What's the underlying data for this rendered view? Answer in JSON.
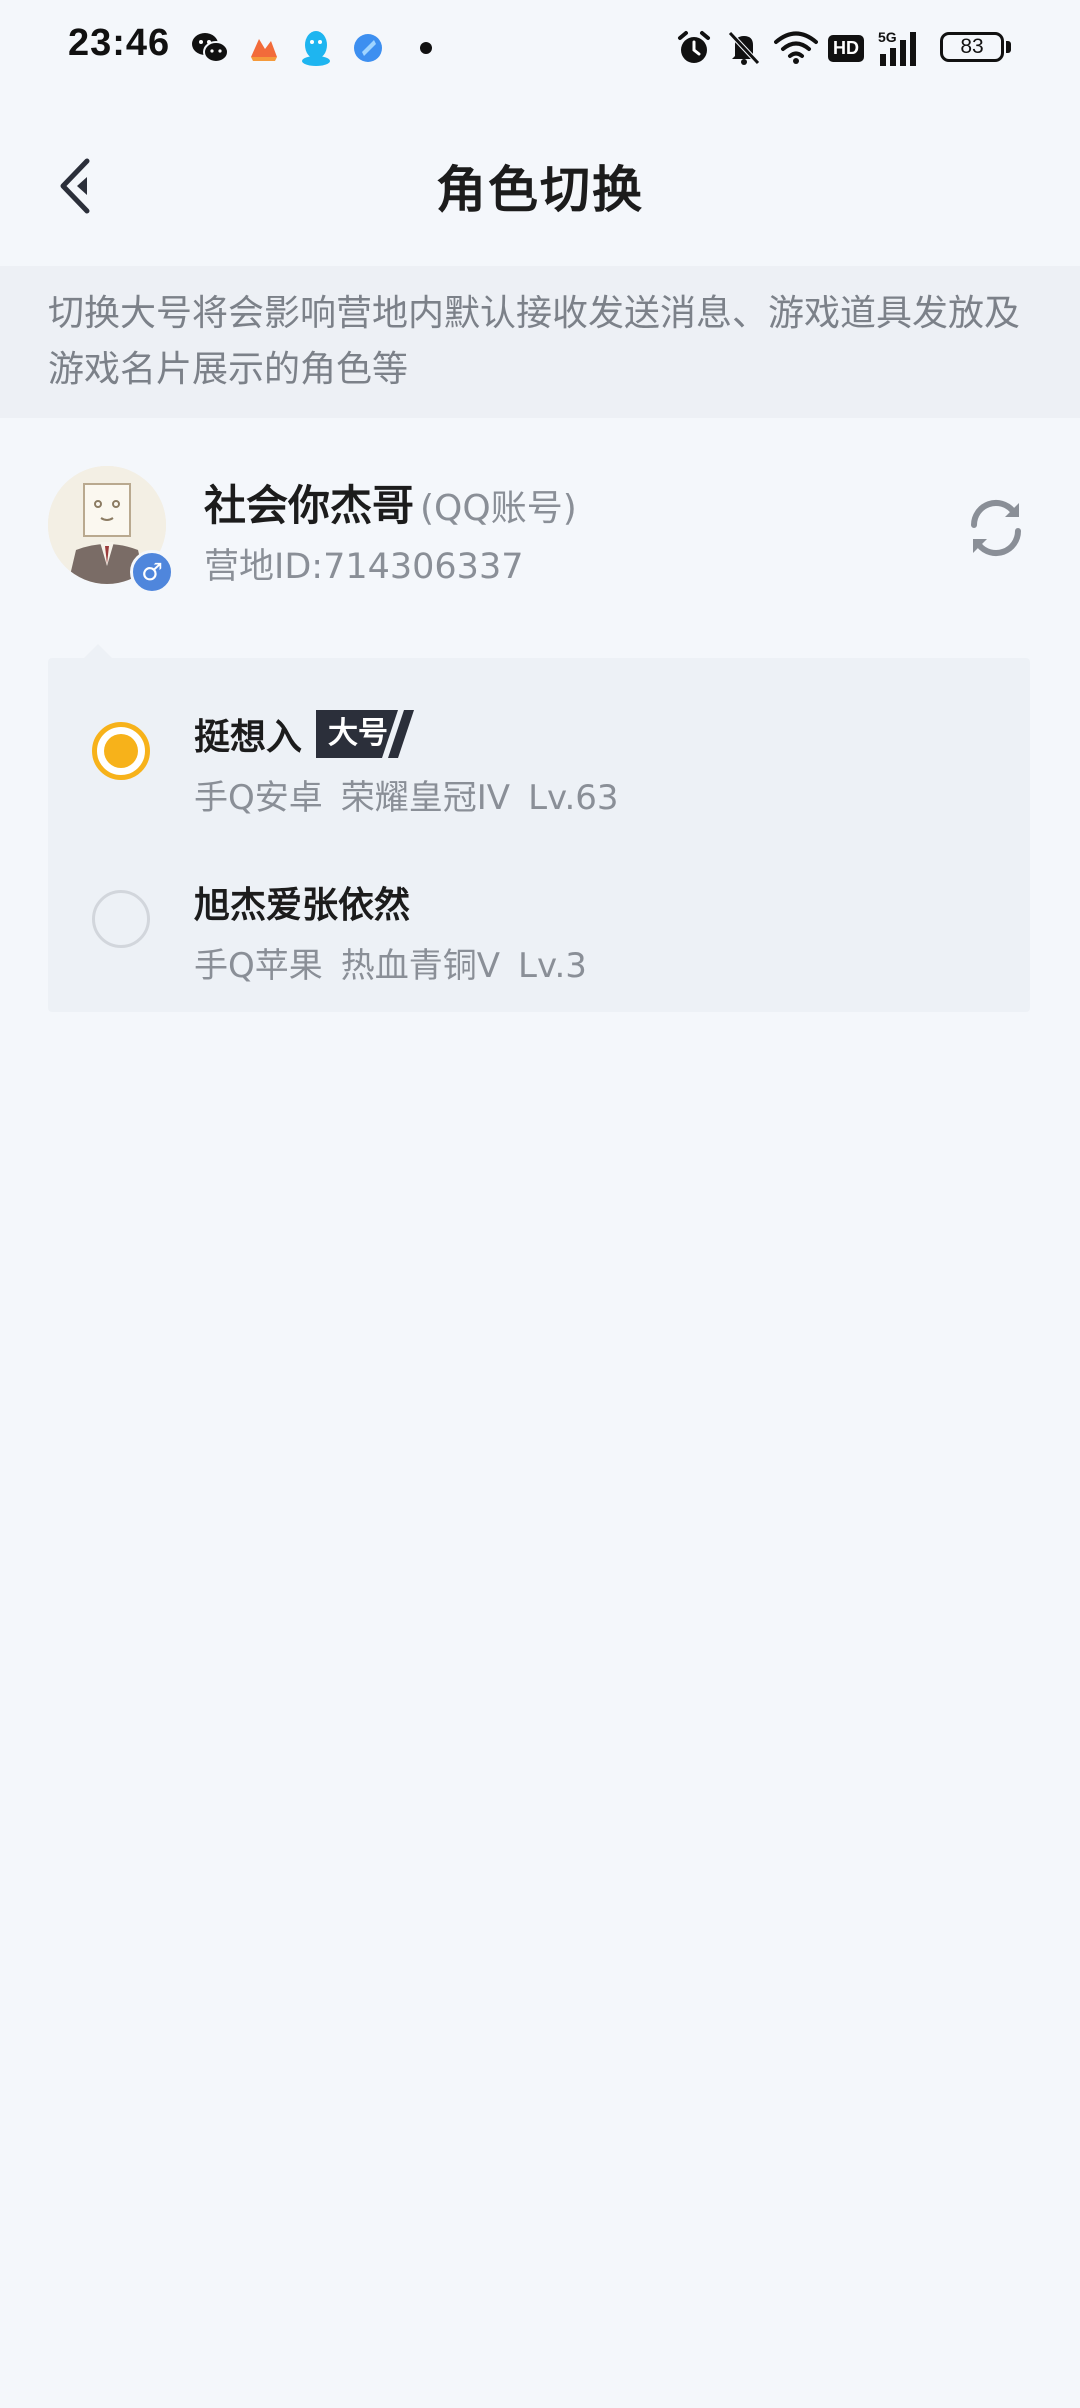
{
  "status_bar": {
    "time": "23:46",
    "battery": "83",
    "network": "5G",
    "hd_label": "HD",
    "notification_icons": [
      "wechat-icon",
      "mango-app-icon",
      "qq-icon",
      "app-icon"
    ],
    "system_icons": [
      "alarm-icon",
      "mute-icon",
      "wifi-icon",
      "hd-icon",
      "signal-icon",
      "battery-icon"
    ]
  },
  "header": {
    "title": "角色切换",
    "back_icon": "chevron-left-icon"
  },
  "notice": {
    "text": "切换大号将会影响营地内默认接收发送消息、游戏道具发放及游戏名片展示的角色等"
  },
  "account": {
    "name": "社会你杰哥",
    "type": "(QQ账号)",
    "id_text": "营地ID:714306337",
    "gender_symbol": "♂",
    "gender_color": "#4f86dc",
    "refresh_icon": "refresh-icon"
  },
  "roles": [
    {
      "name": "挺想入",
      "tag": "大号",
      "platform": "手Q安卓",
      "rank": "荣耀皇冠IV",
      "level": "Lv.63",
      "selected": true
    },
    {
      "name": "旭杰爱张依然",
      "tag": "",
      "platform": "手Q苹果",
      "rank": "热血青铜V",
      "level": "Lv.3",
      "selected": false
    }
  ],
  "colors": {
    "accent": "#f7b21a",
    "background": "#f4f7fb",
    "notice_bg": "#edf0f5",
    "card_bg": "#edf1f6",
    "muted_text": "#8a8f97",
    "tag_bg": "#2b2f3a"
  }
}
